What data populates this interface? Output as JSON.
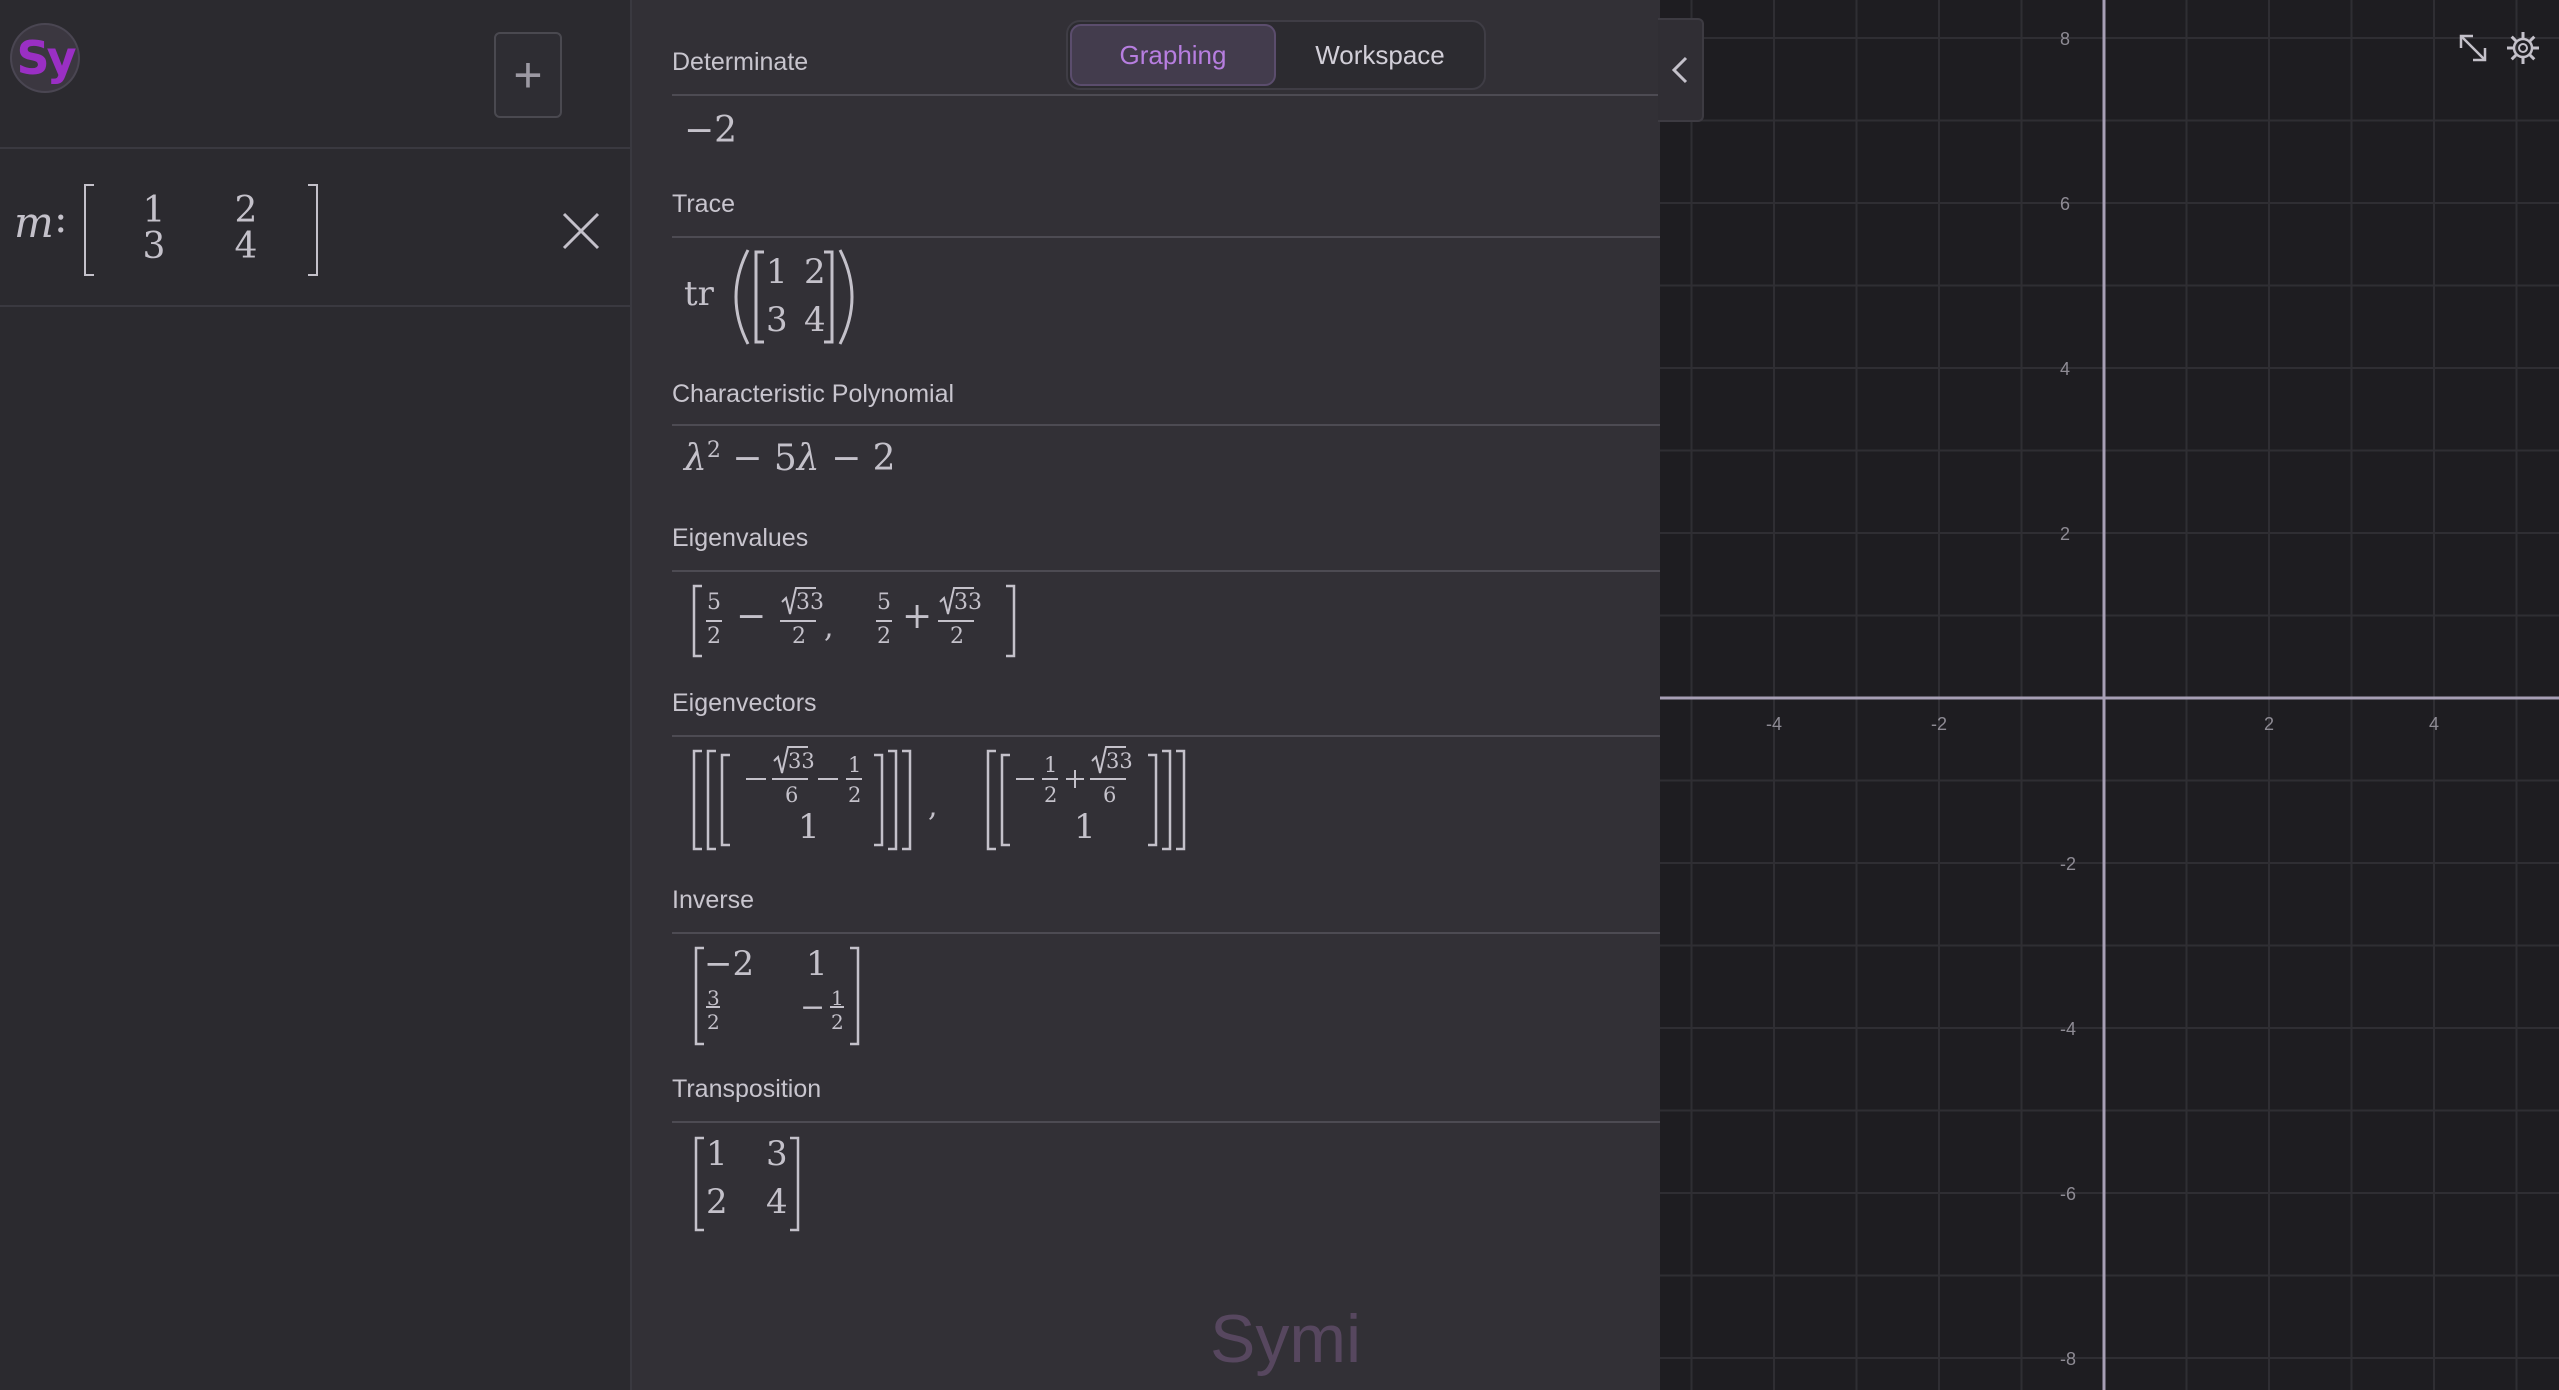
{
  "app": {
    "logo_text": "Sy",
    "watermark": "Symi"
  },
  "left_panel": {
    "add_button_label": "+",
    "entry": {
      "variable": "m",
      "colon": ":",
      "matrix": [
        [
          "1",
          "2"
        ],
        [
          "3",
          "4"
        ]
      ]
    }
  },
  "tabs": [
    {
      "label": "Graphing",
      "active": true
    },
    {
      "label": "Workspace",
      "active": false
    }
  ],
  "results": {
    "determinant": {
      "label": "Determinate",
      "value": "−2"
    },
    "trace": {
      "label": "Trace",
      "func": "tr",
      "matrix": [
        [
          "1",
          "2"
        ],
        [
          "3",
          "4"
        ]
      ]
    },
    "char_poly": {
      "label": "Characteristic Polynomial",
      "lambda": "λ",
      "exp": "2",
      "rest1": "− 5",
      "rest2": "− 2"
    },
    "eigenvalues": {
      "label": "Eigenvalues",
      "half_num": "5",
      "den": "2",
      "sqrt": "33",
      "minus": "−",
      "plus": "+"
    },
    "eigenvectors": {
      "label": "Eigenvectors",
      "sqrt": "33",
      "den6": "6",
      "one": "1",
      "half_num": "1",
      "den2": "2",
      "minus": "−",
      "plus": "+"
    },
    "inverse": {
      "label": "Inverse",
      "a": "−2",
      "b": "1",
      "c_num": "3",
      "c_den": "2",
      "d_sign": "−",
      "d_num": "1",
      "d_den": "2"
    },
    "transposition": {
      "label": "Transposition",
      "matrix": [
        [
          "1",
          "3"
        ],
        [
          "2",
          "4"
        ]
      ]
    }
  },
  "graph": {
    "x_ticks": [
      "-4",
      "-2",
      "2",
      "4"
    ],
    "y_ticks": [
      "8",
      "6",
      "4",
      "2",
      "-2",
      "-4",
      "-6",
      "-8"
    ],
    "axis_color": "#a79fb5",
    "grid_color": "#2f2e33",
    "background": "#1e1d21"
  },
  "colors": {
    "accent": "#b77ee0",
    "logo": "#9a2fc4"
  }
}
